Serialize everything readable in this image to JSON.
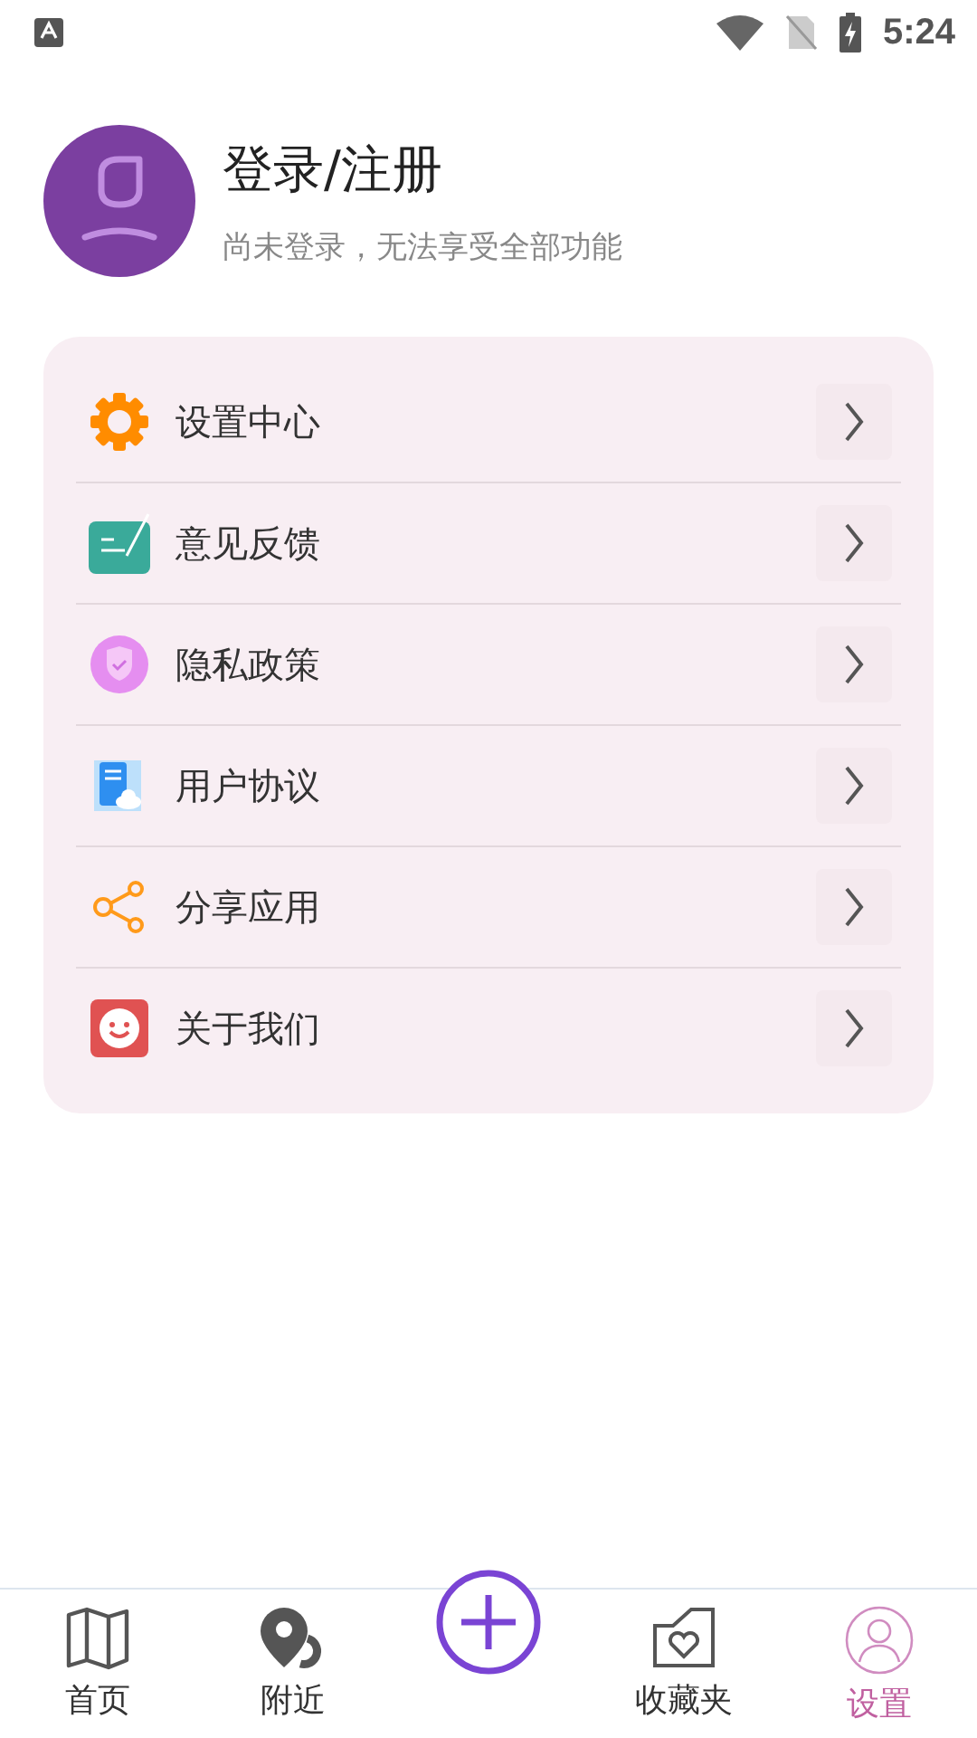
{
  "status_bar": {
    "time": "5:24"
  },
  "profile": {
    "title": "登录/注册",
    "subtitle": "尚未登录，无法享受全部功能"
  },
  "menu": [
    {
      "kind": "gear",
      "label": "设置中心"
    },
    {
      "kind": "feedback",
      "label": "意见反馈"
    },
    {
      "kind": "shield",
      "label": "隐私政策"
    },
    {
      "kind": "document",
      "label": "用户协议"
    },
    {
      "kind": "share",
      "label": "分享应用"
    },
    {
      "kind": "smile",
      "label": "关于我们"
    }
  ],
  "nav": [
    {
      "kind": "map",
      "label": "首页",
      "selected": false
    },
    {
      "kind": "pin",
      "label": "附近",
      "selected": false
    },
    {
      "kind": "add"
    },
    {
      "kind": "folder",
      "label": "收藏夹",
      "selected": false
    },
    {
      "kind": "person",
      "label": "设置",
      "selected": true
    }
  ]
}
